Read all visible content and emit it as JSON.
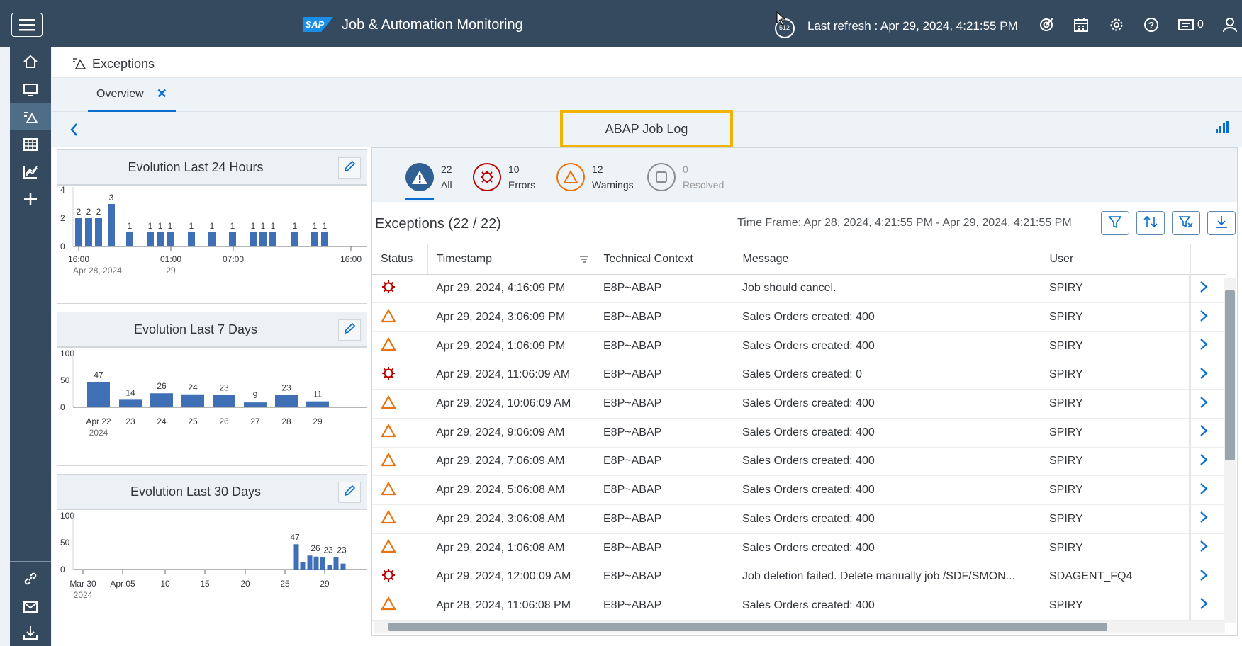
{
  "shell": {
    "title": "Job & Automation Monitoring",
    "logo": "SAP",
    "refresh_badge": "512",
    "last_refresh": "Last refresh : Apr 29, 2024, 4:21:55 PM",
    "notification_count": "0",
    "icons": [
      "menu-icon",
      "refresh-icon",
      "target-icon",
      "calendar-icon",
      "gear-icon",
      "help-icon",
      "notifications-icon",
      "user-icon"
    ]
  },
  "nav": {
    "icons": [
      "home-icon",
      "monitor-icon",
      "exceptions-icon",
      "table-icon",
      "analytics-icon",
      "add-icon",
      "link-icon",
      "mail-icon",
      "download-icon"
    ]
  },
  "page": {
    "title": "Exceptions",
    "tab": "Overview",
    "highlight": "ABAP Job Log"
  },
  "panels": {
    "p24": {
      "title": "Evolution Last 24 Hours"
    },
    "p7": {
      "title": "Evolution Last 7 Days"
    },
    "p30": {
      "title": "Evolution Last 30 Days"
    }
  },
  "chart_data": [
    {
      "type": "bar",
      "title": "Evolution Last 24 Hours",
      "ylim": [
        0,
        4
      ],
      "yticks": [
        "0",
        "2",
        "4"
      ],
      "xtick_labels": [
        "16:00",
        "01:00",
        "07:00",
        "16:00"
      ],
      "xtick_sublabels": [
        "Apr 28, 2024",
        "29"
      ],
      "values": [
        2,
        2,
        2,
        3,
        1,
        1,
        1,
        1,
        1,
        1,
        1,
        1,
        1,
        1,
        1,
        1,
        1
      ],
      "labels": [
        "2",
        "2",
        "2",
        "3",
        "1",
        "1",
        "1",
        "1",
        "1",
        "1",
        "1",
        "1",
        "1",
        "1",
        "1",
        "1",
        "1"
      ]
    },
    {
      "type": "bar",
      "title": "Evolution Last 7 Days",
      "ylim": [
        0,
        100
      ],
      "yticks": [
        "0",
        "50",
        "100"
      ],
      "categories": [
        "Apr 22",
        "23",
        "24",
        "25",
        "26",
        "27",
        "28",
        "29"
      ],
      "category_sublabel": "2024",
      "values": [
        47,
        14,
        26,
        24,
        23,
        9,
        23,
        11
      ]
    },
    {
      "type": "bar",
      "title": "Evolution Last 30 Days",
      "ylim": [
        0,
        100
      ],
      "yticks": [
        "0",
        "50",
        "100"
      ],
      "xtick_labels": [
        "Mar 30",
        "Apr 05",
        "10",
        "15",
        "20",
        "25",
        "29"
      ],
      "xtick_sublabel": "2024",
      "values": [
        47,
        14,
        26,
        24,
        23,
        9,
        23,
        11
      ],
      "labels": [
        "47",
        "",
        "26",
        "",
        "23",
        "",
        "23",
        ""
      ]
    }
  ],
  "counters": [
    {
      "count": "22",
      "label": "All",
      "icon": "warning-filled-icon",
      "color": "#2f5f93"
    },
    {
      "count": "10",
      "label": "Errors",
      "icon": "error-icon",
      "color": "#bb0000"
    },
    {
      "count": "12",
      "label": "Warnings",
      "icon": "warning-icon",
      "color": "#e9730c"
    },
    {
      "count": "0",
      "label": "Resolved",
      "icon": "resolved-icon",
      "color": "#8c8c8c"
    }
  ],
  "exceptions": {
    "title": "Exceptions (22 / 22)",
    "timeframe": "Time Frame: Apr 28, 2024, 4:21:55 PM - Apr 29, 2024, 4:21:55 PM",
    "toolbar": [
      "filter-icon",
      "sort-icon",
      "clear-filter-icon",
      "download-icon"
    ],
    "columns": [
      "Status",
      "Timestamp",
      "Technical Context",
      "Message",
      "User"
    ],
    "rows": [
      {
        "status": "error",
        "timestamp": "Apr 29, 2024, 4:16:09 PM",
        "context": "E8P~ABAP",
        "message": "Job should cancel.",
        "user": "SPIRY"
      },
      {
        "status": "warning",
        "timestamp": "Apr 29, 2024, 3:06:09 PM",
        "context": "E8P~ABAP",
        "message": "Sales Orders created: 400",
        "user": "SPIRY"
      },
      {
        "status": "warning",
        "timestamp": "Apr 29, 2024, 1:06:09 PM",
        "context": "E8P~ABAP",
        "message": "Sales Orders created: 400",
        "user": "SPIRY"
      },
      {
        "status": "error",
        "timestamp": "Apr 29, 2024, 11:06:09 AM",
        "context": "E8P~ABAP",
        "message": "Sales Orders created: 0",
        "user": "SPIRY"
      },
      {
        "status": "warning",
        "timestamp": "Apr 29, 2024, 10:06:09 AM",
        "context": "E8P~ABAP",
        "message": "Sales Orders created: 400",
        "user": "SPIRY"
      },
      {
        "status": "warning",
        "timestamp": "Apr 29, 2024, 9:06:09 AM",
        "context": "E8P~ABAP",
        "message": "Sales Orders created: 400",
        "user": "SPIRY"
      },
      {
        "status": "warning",
        "timestamp": "Apr 29, 2024, 7:06:09 AM",
        "context": "E8P~ABAP",
        "message": "Sales Orders created: 400",
        "user": "SPIRY"
      },
      {
        "status": "warning",
        "timestamp": "Apr 29, 2024, 5:06:08 AM",
        "context": "E8P~ABAP",
        "message": "Sales Orders created: 400",
        "user": "SPIRY"
      },
      {
        "status": "warning",
        "timestamp": "Apr 29, 2024, 3:06:08 AM",
        "context": "E8P~ABAP",
        "message": "Sales Orders created: 400",
        "user": "SPIRY"
      },
      {
        "status": "warning",
        "timestamp": "Apr 29, 2024, 1:06:08 AM",
        "context": "E8P~ABAP",
        "message": "Sales Orders created: 400",
        "user": "SPIRY"
      },
      {
        "status": "error",
        "timestamp": "Apr 29, 2024, 12:00:09 AM",
        "context": "E8P~ABAP",
        "message": "Job deletion failed. Delete manually job /SDF/SMON...",
        "user": "SDAGENT_FQ4"
      },
      {
        "status": "warning",
        "timestamp": "Apr 28, 2024, 11:06:08 PM",
        "context": "E8P~ABAP",
        "message": "Sales Orders created: 400",
        "user": "SPIRY"
      }
    ]
  },
  "colors": {
    "shell": "#354a5f",
    "accent": "#0a6ed1",
    "bar": "#3f6fb5",
    "error": "#bb0000",
    "warning": "#e9730c",
    "highlight": "#f0b400"
  }
}
